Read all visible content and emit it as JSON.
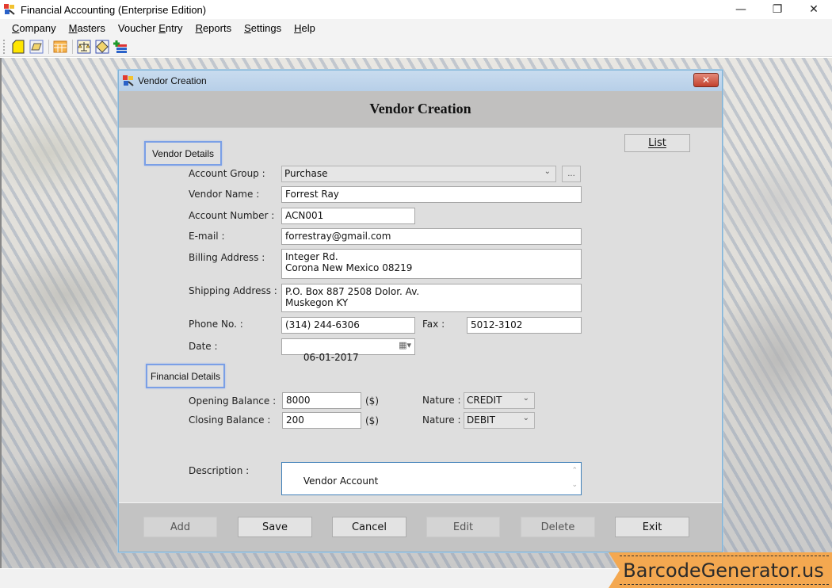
{
  "window": {
    "title": "Financial Accounting (Enterprise Edition)",
    "controls": {
      "minimize": "—",
      "restore": "❐",
      "close": "✕"
    }
  },
  "menubar": {
    "items": [
      {
        "label": "Company",
        "accel": "C"
      },
      {
        "label": "Masters",
        "accel": "M"
      },
      {
        "label": "Voucher Entry",
        "accel": "E"
      },
      {
        "label": "Reports",
        "accel": "R"
      },
      {
        "label": "Settings",
        "accel": "S"
      },
      {
        "label": "Help",
        "accel": "H"
      }
    ]
  },
  "toolbar": {
    "buttons": [
      {
        "icon": "new-document-icon"
      },
      {
        "icon": "open-folder-icon"
      },
      {
        "icon": "grid-table-icon"
      },
      {
        "icon": "balance-scale-icon"
      },
      {
        "icon": "ledger-book-icon"
      },
      {
        "icon": "add-list-icon"
      }
    ]
  },
  "dialog": {
    "title": "Vendor Creation",
    "close_label": "✕",
    "header_title": "Vendor Creation",
    "list_button": "List",
    "sections": {
      "vendor_details": "Vendor Details",
      "financial_details": "Financial Details"
    },
    "fields": {
      "account_group": {
        "label": "Account Group :",
        "value": "Purchase",
        "browse": "..."
      },
      "vendor_name": {
        "label": "Vendor Name :",
        "value": "Forrest Ray"
      },
      "account_number": {
        "label": "Account Number :",
        "value": "ACN001"
      },
      "email": {
        "label": "E-mail :",
        "value": "forrestray@gmail.com"
      },
      "billing_address": {
        "label": "Billing Address :",
        "value": "Integer Rd.\nCorona New Mexico 08219"
      },
      "shipping_address": {
        "label": "Shipping Address :",
        "value": "P.O. Box 887 2508 Dolor. Av.\nMuskegon KY"
      },
      "phone": {
        "label": "Phone No. :",
        "value": "(314) 244-6306"
      },
      "fax": {
        "label": "Fax :",
        "value": "5012-3102"
      },
      "date": {
        "label": "Date :",
        "value": "06-01-2017"
      },
      "opening_balance": {
        "label": "Opening Balance :",
        "value": "8000",
        "unit": "($)"
      },
      "closing_balance": {
        "label": "Closing Balance :",
        "value": "200",
        "unit": "($)"
      },
      "opening_nature": {
        "label": "Nature :",
        "value": "CREDIT"
      },
      "closing_nature": {
        "label": "Nature :",
        "value": "DEBIT"
      },
      "description": {
        "label": "Description :",
        "value": "Vendor Account"
      }
    },
    "buttons": [
      {
        "id": "add",
        "label": "Add",
        "enabled": false
      },
      {
        "id": "save",
        "label": "Save",
        "enabled": true
      },
      {
        "id": "cancel",
        "label": "Cancel",
        "enabled": true
      },
      {
        "id": "edit",
        "label": "Edit",
        "enabled": false
      },
      {
        "id": "delete",
        "label": "Delete",
        "enabled": false
      },
      {
        "id": "exit",
        "label": "Exit",
        "enabled": true
      }
    ]
  },
  "badge": {
    "text": "BarcodeGenerator.us",
    "color": "#f4a850"
  }
}
